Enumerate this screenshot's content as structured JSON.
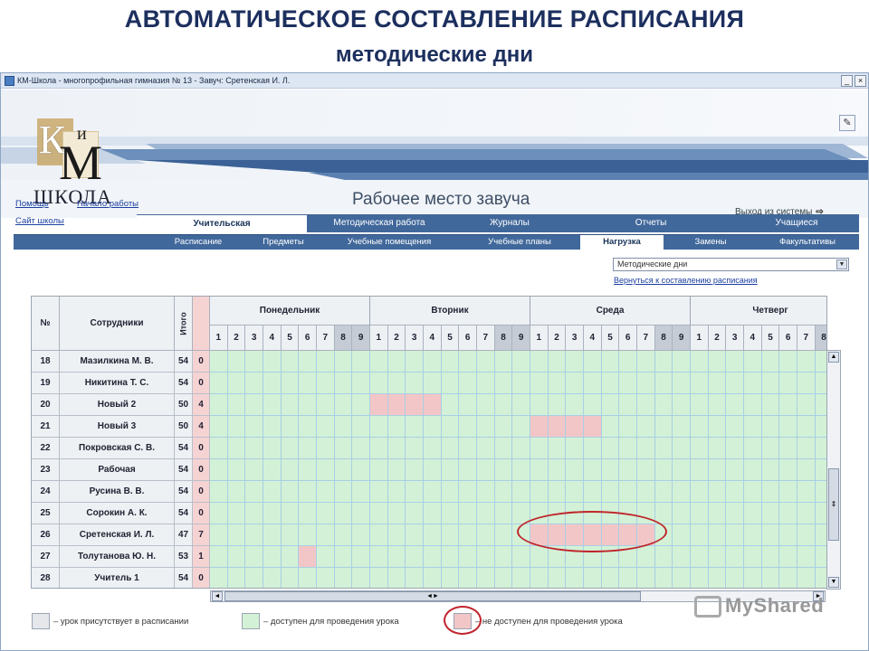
{
  "slide": {
    "title": "АВТОМАТИЧЕСКОЕ СОСТАВЛЕНИЕ РАСПИСАНИЯ",
    "subtitle": "методические дни"
  },
  "window": {
    "title": "КМ-Школа - многопрофильная гимназия № 13 - Завуч: Сретенская И. Л.",
    "min": "_",
    "close": "×"
  },
  "banner": {
    "logo_k": "К",
    "logo_i": "и",
    "logo_m": "М",
    "logo_school": "ШКОЛА",
    "workspace_title": "Рабочее место завуча",
    "exit_label": "Выход из системы",
    "exit_icon": "⇨"
  },
  "links": {
    "help": "Помощь",
    "start": "Начало работы",
    "site": "Сайт школы"
  },
  "tabs_main": [
    {
      "label": "Учительская",
      "active": true
    },
    {
      "label": "Методическая работа",
      "active": false
    },
    {
      "label": "Журналы",
      "active": false
    },
    {
      "label": "Отчеты",
      "active": false
    },
    {
      "label": "Учащиеся",
      "active": false
    }
  ],
  "tabs_sub": [
    {
      "label": "Расписание",
      "active": false
    },
    {
      "label": "Предметы",
      "active": false
    },
    {
      "label": "Учебные помещения",
      "active": false
    },
    {
      "label": "Учебные планы",
      "active": false
    },
    {
      "label": "Нагрузка",
      "active": true
    },
    {
      "label": "Замены",
      "active": false
    },
    {
      "label": "Факультативы",
      "active": false
    }
  ],
  "select": {
    "value": "Методические дни",
    "arrow": "▼"
  },
  "back_link": "Вернуться к составлению расписания",
  "table": {
    "headers": {
      "num": "№",
      "staff": "Сотрудники",
      "total": "Итого"
    },
    "days": [
      "Понедельник",
      "Вторник",
      "Среда",
      "Четверг"
    ],
    "lessons": [
      "1",
      "2",
      "3",
      "4",
      "5",
      "6",
      "7",
      "8",
      "9"
    ],
    "thursday_lessons": [
      "1",
      "2",
      "3",
      "4",
      "5",
      "6",
      "7",
      "8"
    ],
    "rows": [
      {
        "num": "18",
        "name": "Мазилкина М. В.",
        "total": "54",
        "extra": "0"
      },
      {
        "num": "19",
        "name": "Никитина Т. С.",
        "total": "54",
        "extra": "0"
      },
      {
        "num": "20",
        "name": "Новый 2",
        "total": "50",
        "extra": "4"
      },
      {
        "num": "21",
        "name": "Новый 3",
        "total": "50",
        "extra": "4"
      },
      {
        "num": "22",
        "name": "Покровская С. В.",
        "total": "54",
        "extra": "0"
      },
      {
        "num": "23",
        "name": "Рабочая",
        "total": "54",
        "extra": "0"
      },
      {
        "num": "24",
        "name": "Русина В. В.",
        "total": "54",
        "extra": "0"
      },
      {
        "num": "25",
        "name": "Сорокин А. К.",
        "total": "54",
        "extra": "0"
      },
      {
        "num": "26",
        "name": "Сретенская И. Л.",
        "total": "47",
        "extra": "7"
      },
      {
        "num": "27",
        "name": "Толутанова Ю. Н.",
        "total": "53",
        "extra": "1"
      },
      {
        "num": "28",
        "name": "Учитель 1",
        "total": "54",
        "extra": "0"
      }
    ],
    "unavailable": [
      {
        "row": 2,
        "day": 1,
        "lessons": [
          1,
          2,
          3,
          4
        ]
      },
      {
        "row": 3,
        "day": 2,
        "lessons": [
          1,
          2,
          3,
          4
        ]
      },
      {
        "row": 8,
        "day": 2,
        "lessons": [
          1,
          2,
          3,
          4,
          5,
          6,
          7
        ]
      },
      {
        "row": 9,
        "day": 0,
        "lessons": [
          6
        ]
      }
    ]
  },
  "scroll": {
    "up": "▲",
    "down": "▼",
    "left": "◄",
    "right": "►",
    "grip": "◄►",
    "vgrip": "⇕"
  },
  "legend": [
    {
      "color": "#e5e7ea",
      "text": "– урок присутствует в расписании"
    },
    {
      "color": "#d3f1d6",
      "text": "– доступен для проведения урока"
    },
    {
      "color": "#f2c6c6",
      "text": "– не доступен для проведения урока"
    }
  ],
  "watermark": "MyShared",
  "colors": {
    "available": "#d3f1d6",
    "unavailable": "#f2c6c6",
    "tabs": "#41689b",
    "title": "#1c2f5e",
    "highlight": "#c0242c"
  }
}
